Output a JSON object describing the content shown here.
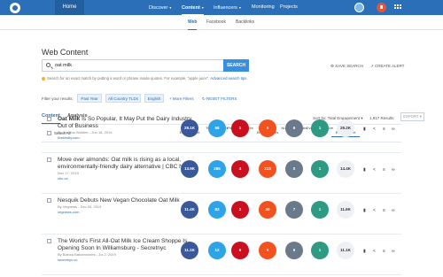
{
  "topnav": {
    "home": "Home",
    "items": [
      {
        "label": "Discover",
        "caret": "▾"
      },
      {
        "label": "Content",
        "caret": "▾"
      },
      {
        "label": "Influencers",
        "caret": "▾"
      },
      {
        "label": "Monitoring",
        "caret": ""
      },
      {
        "label": "Projects",
        "caret": ""
      }
    ]
  },
  "subnav": [
    "Web",
    "Facebook",
    "Backlinks"
  ],
  "page_title": "Web Content",
  "search": {
    "value": "oat milk",
    "button": "SEARCH"
  },
  "actions": {
    "save": "SAVE SEARCH",
    "alert": "CREATE ALERT"
  },
  "hint": {
    "text": "Search for an exact match by putting a word or phrase inside quotes. For example, \"apple juice\".",
    "link": "Advanced search tips"
  },
  "filters": {
    "label": "Filter your results:",
    "chips": [
      "Past Year",
      "All Country TLDs",
      "English"
    ],
    "more": "+ More Filters",
    "reset": "RESET FILTERS"
  },
  "tabs": [
    "Content",
    "Analysis"
  ],
  "sort": "Sort by: Total Engagement ▾",
  "results": "1,917 Results",
  "export": "EXPORT ▾",
  "select_all": "Select All",
  "columns": [
    "Facebook Engagement",
    "Twitter Shares",
    "Pinterest Shares",
    "Reddit Engagements",
    "Number of Links",
    "Evergreen Score",
    "Total Engagement"
  ],
  "rows": [
    {
      "title_bold": "Oat Milk",
      "title_rest": " Is So Popular, It May Put the Dairy Industry Out of Business",
      "meta": "By Jemima Webber - Jun 18, 2019",
      "url": "livekindly.com",
      "values": [
        "29.1K",
        "58",
        "1",
        "0",
        "6",
        "1",
        "29.2K"
      ]
    },
    {
      "title_bold": "",
      "title_rest": "Move over almonds: Oat milk is rising as a local, environmentally-friendly dairy alternative | CBC News",
      "meta": "Nov 17, 2019",
      "url": "cbc.ca",
      "values": [
        "13.9K",
        "285",
        "4",
        "223",
        "0",
        "1",
        "14.4K"
      ]
    },
    {
      "title_bold": "",
      "title_rest": "Nesquik Debuts New Vegan Chocolate Oat Milk",
      "meta": "By Vegnews - Dec 05, 2019",
      "url": "vegnews.com",
      "values": [
        "11.4K",
        "83",
        "2",
        "30",
        "7",
        "1",
        "11.6K"
      ]
    },
    {
      "title_bold": "",
      "title_rest": "The World's First All-Oat Milk Ice Cream Shoppe Is Opening Soon In Williamsburg - Secretnyc",
      "meta": "By Bianca Bahamondes - Jul 2, 2019",
      "url": "secretnyc.co",
      "values": [
        "11.1K",
        "12",
        "0",
        "0",
        "6",
        "1",
        "11.1K"
      ]
    }
  ],
  "colors": {
    "topbar": "#2a6fb8",
    "facebook": "#3b5998",
    "twitter": "#2fa3e6",
    "pinterest": "#c8101e",
    "reddit": "#f2521f",
    "links": "#6a7a8a",
    "evergreen": "#2f9a83"
  }
}
